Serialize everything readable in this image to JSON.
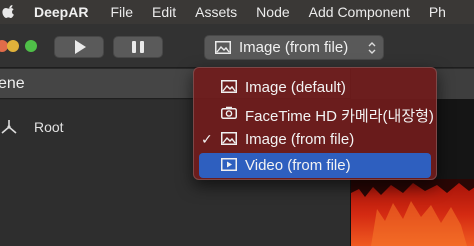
{
  "menubar": {
    "app_name": "DeepAR",
    "items": [
      "File",
      "Edit",
      "Assets",
      "Node",
      "Add Component",
      "Ph"
    ]
  },
  "toolbar": {
    "play_icon": "play-icon",
    "pause_icon": "pause-icon",
    "source_select": {
      "value": "Image (from file)",
      "icon": "image-icon"
    }
  },
  "scene": {
    "title": "ene",
    "tree": [
      {
        "label": "Root",
        "icon": "node-axes-icon"
      }
    ]
  },
  "dropdown": {
    "items": [
      {
        "label": "Image (default)",
        "icon": "image-icon",
        "checked": false,
        "highlighted": false
      },
      {
        "label": "FaceTime HD 카메라(내장형)",
        "icon": "camera-icon",
        "checked": false,
        "highlighted": false
      },
      {
        "label": "Image (from file)",
        "icon": "image-icon",
        "checked": true,
        "highlighted": false
      },
      {
        "label": "Video (from file)",
        "icon": "video-icon",
        "checked": false,
        "highlighted": true
      }
    ]
  },
  "colors": {
    "menu_background": "#701c1c",
    "highlight": "#2e5fbf",
    "preview_fire": "#d42a12"
  }
}
